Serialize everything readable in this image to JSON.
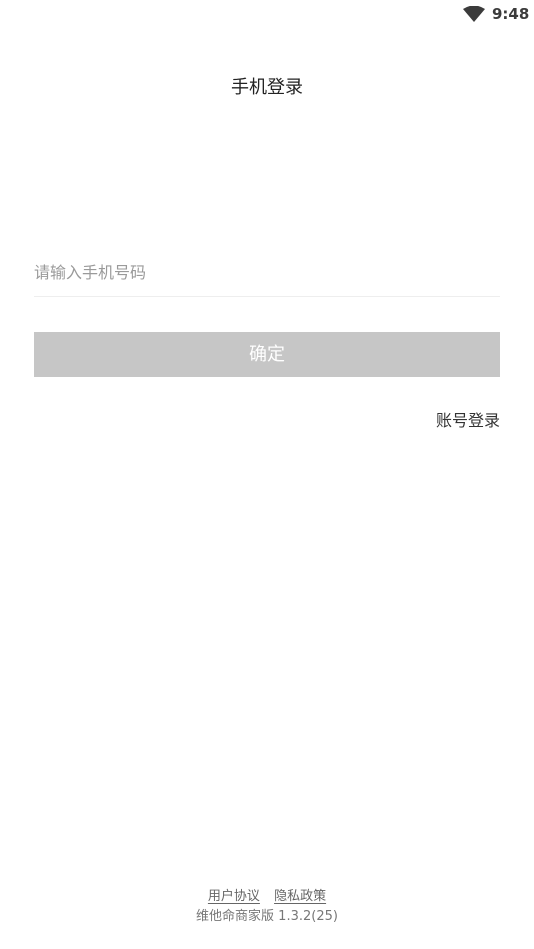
{
  "status_bar": {
    "time": "9:48",
    "wifi_icon": "wifi-icon"
  },
  "page": {
    "title": "手机登录"
  },
  "phone_input": {
    "placeholder": "请输入手机号码",
    "value": ""
  },
  "confirm_button": {
    "label": "确定",
    "color": "#c6c6c6"
  },
  "account_login": {
    "label": "账号登录"
  },
  "footer": {
    "user_agreement": "用户协议",
    "privacy_policy": "隐私政策",
    "version": "维他命商家版 1.3.2(25)"
  }
}
